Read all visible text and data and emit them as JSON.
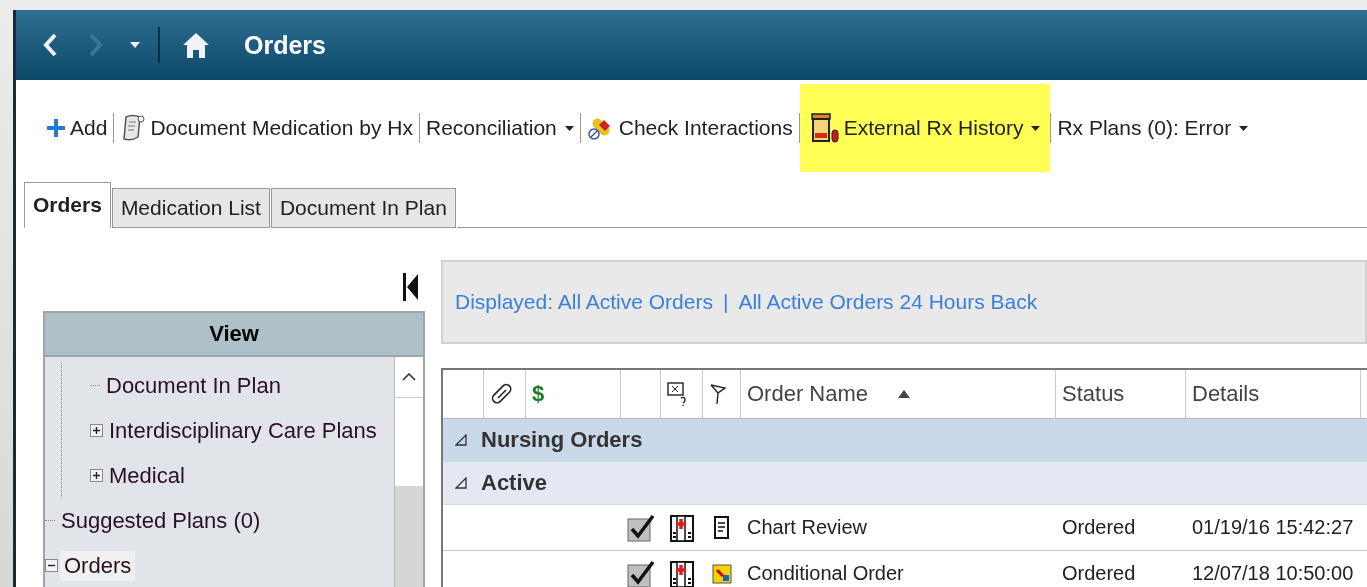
{
  "window": {
    "title": "Orders",
    "back_enabled": true,
    "forward_enabled": false
  },
  "toolbar": [
    {
      "label": "Add",
      "dropdown": false,
      "highlighted": false
    },
    {
      "label": "Document Medication by Hx",
      "dropdown": false,
      "highlighted": false
    },
    {
      "label": "Reconciliation",
      "dropdown": true,
      "highlighted": false
    },
    {
      "label": "Check Interactions",
      "dropdown": false,
      "highlighted": false
    },
    {
      "label": "External Rx History",
      "dropdown": true,
      "highlighted": true
    },
    {
      "label": "Rx Plans (0): Error",
      "dropdown": true,
      "highlighted": false
    }
  ],
  "tabs": [
    {
      "label": "Orders",
      "selected": true
    },
    {
      "label": "Medication List",
      "selected": false
    },
    {
      "label": "Document In Plan",
      "selected": false
    }
  ],
  "view": {
    "title": "View",
    "items": [
      {
        "children": [
          {
            "label": "Document In Plan",
            "selected": false
          },
          {
            "label": "Interdisciplinary Care Plans",
            "expanded": false,
            "selected": false
          },
          {
            "label": "Medical",
            "expanded": false,
            "selected": false
          }
        ]
      },
      {
        "label": "Suggested Plans (0)",
        "selected": false
      },
      {
        "label": "Orders",
        "expanded": true,
        "selected": true
      }
    ]
  },
  "filter": {
    "links": [
      "Displayed: All Active Orders",
      "All Active Orders 24 Hours Back"
    ],
    "separator": "|"
  },
  "table": {
    "columns": [
      "",
      "",
      "$",
      "",
      "",
      "",
      "Order Name",
      "Status",
      "Details"
    ],
    "sort_ascending": true,
    "groups": [
      {
        "label": "Nursing Orders",
        "expanded": true
      },
      {
        "label": "Active",
        "expanded": true
      }
    ],
    "rows": [
      {
        "checked": true,
        "order_name": "Chart Review",
        "status": "Ordered",
        "details": "01/19/16 15:42:27"
      },
      {
        "checked": true,
        "order_name": "Conditional Order",
        "status": "Ordered",
        "details": "12/07/18 10:50:00"
      }
    ]
  }
}
